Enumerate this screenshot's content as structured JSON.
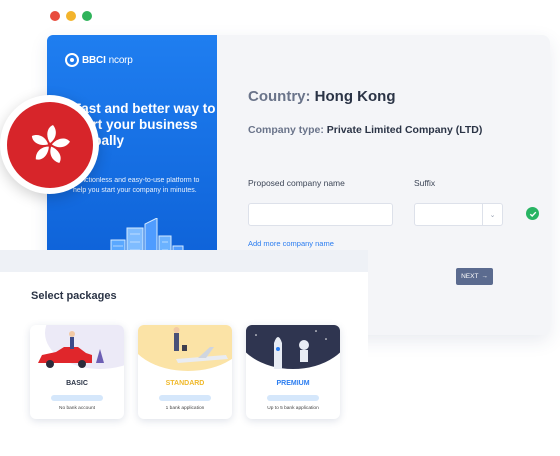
{
  "window_controls": [
    {
      "name": "close",
      "color": "#e84c3d"
    },
    {
      "name": "minimize",
      "color": "#f3b42c"
    },
    {
      "name": "maximize",
      "color": "#2fb35a"
    }
  ],
  "hero": {
    "brand_bold": "BBCI",
    "brand_thin": "ncorp",
    "headline": "Fast and better way to start your business globally",
    "subtext": "A frictionless and easy-to-use platform to help you start your company in minutes."
  },
  "form": {
    "country_label": "Country:",
    "country_value": "Hong Kong",
    "company_type_label": "Company type:",
    "company_type_value": "Private Limited Company (LTD)",
    "name_label": "Proposed company name",
    "name_value": "",
    "suffix_label": "Suffix",
    "suffix_value": "",
    "add_more_link": "Add more company name",
    "next_button": "NEXT",
    "next_arrow": "→",
    "accent_color": "#2b7df0"
  },
  "packages": {
    "title": "Select packages",
    "items": [
      {
        "name": "BASIC",
        "desc": "No bank account",
        "name_color": "#2b3446"
      },
      {
        "name": "STANDARD",
        "desc": "1 bank application",
        "name_color": "#f0b92b"
      },
      {
        "name": "PREMIUM",
        "desc": "Up to 5 bank application",
        "name_color": "#2b7df0"
      }
    ]
  }
}
